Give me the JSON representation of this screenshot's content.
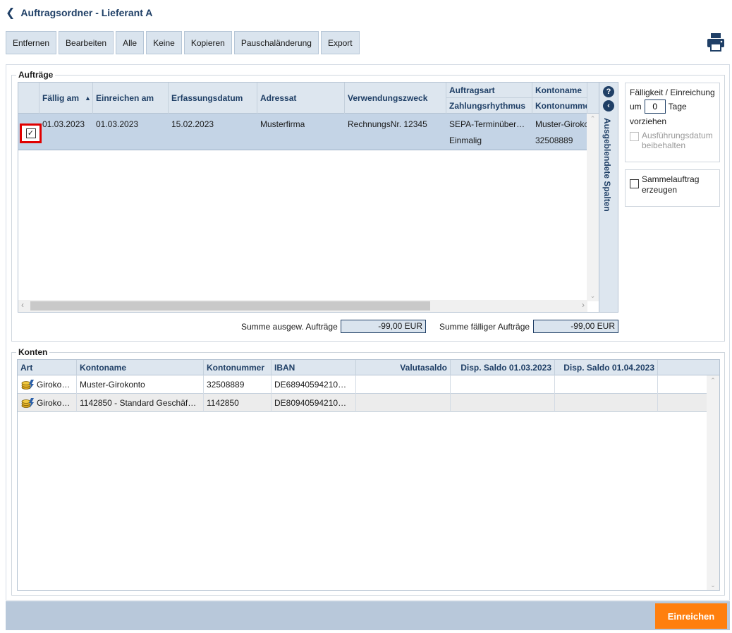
{
  "header": {
    "title": "Auftragsordner - Lieferant A"
  },
  "toolbar": {
    "buttons": [
      "Entfernen",
      "Bearbeiten",
      "Alle",
      "Keine",
      "Kopieren",
      "Pauschaländerung",
      "Export"
    ]
  },
  "auftraege": {
    "legend": "Aufträge",
    "columns": {
      "faellig": "Fällig am",
      "einreichen": "Einreichen am",
      "erfassung": "Erfassungsdatum",
      "adressat": "Adressat",
      "verwendung": "Verwendungszweck",
      "auftragsart": "Auftragsart",
      "zahlungsrhythmus": "Zahlungsrhythmus",
      "kontoname": "Kontoname",
      "kontonummer": "Kontonummer"
    },
    "rows": [
      {
        "checked": true,
        "faellig": "01.03.2023",
        "einreichen": "01.03.2023",
        "erfassung": "15.02.2023",
        "adressat": "Musterfirma",
        "verwendung": "RechnungsNr. 12345",
        "auftragsart": "SEPA-Terminüber…",
        "zahlungsrhythmus": "Einmalig",
        "kontoname": "Muster-Girokonto",
        "kontonummer": "32508889"
      }
    ],
    "hidden_columns_label": "Ausgeblendete Spalten",
    "sum_selected_label": "Summe ausgew. Aufträge",
    "sum_selected_value": "-99,00 EUR",
    "sum_due_label": "Summe fälliger Aufträge",
    "sum_due_value": "-99,00 EUR"
  },
  "options": {
    "title": "Fälligkeit / Einreichung",
    "um": "um",
    "days_value": "0",
    "tage": "Tage",
    "vorziehen": "vorziehen",
    "keep_date_label": "Ausführungsdatum beibehalten",
    "collective_label": "Sammelauftrag erzeugen"
  },
  "konten": {
    "legend": "Konten",
    "columns": {
      "art": "Art",
      "kontoname": "Kontoname",
      "kontonummer": "Kontonummer",
      "iban": "IBAN",
      "valutasaldo": "Valutasaldo",
      "disp1": "Disp. Saldo 01.03.2023",
      "disp2": "Disp. Saldo 01.04.2023"
    },
    "rows": [
      {
        "art": "Giroko…",
        "kontoname": "Muster-Girokonto",
        "kontonummer": "32508889",
        "iban": "DE68940594210…",
        "valutasaldo": "",
        "disp1": "",
        "disp2": ""
      },
      {
        "art": "Giroko…",
        "kontoname": "1142850 - Standard Geschäf…",
        "kontonummer": "1142850",
        "iban": "DE80940594210…",
        "valutasaldo": "",
        "disp1": "",
        "disp2": ""
      }
    ]
  },
  "footer": {
    "submit_label": "Einreichen"
  },
  "colors": {
    "primary": "#1f3f66",
    "accent": "#ff7f0e",
    "header_bg": "#dde6ef",
    "selected_row": "#c4d4e6",
    "highlight": "#e00000"
  }
}
